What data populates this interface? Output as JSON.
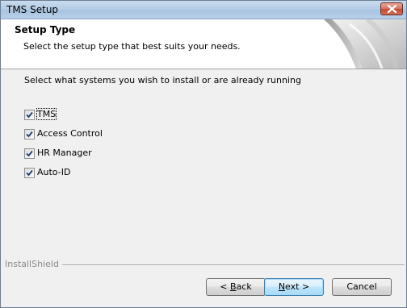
{
  "window": {
    "title": "TMS Setup"
  },
  "header": {
    "title": "Setup Type",
    "subtitle": "Select the setup type that best suits your needs."
  },
  "main": {
    "prompt": "Select what systems you wish to install or are already running",
    "options": [
      {
        "label": "TMS",
        "checked": true
      },
      {
        "label": "Access Control",
        "checked": true
      },
      {
        "label": "HR Manager",
        "checked": true
      },
      {
        "label": "Auto-ID",
        "checked": true
      }
    ]
  },
  "footer": {
    "brand": "InstallShield",
    "back": {
      "mnemonic": "B",
      "rest": "ack",
      "prefix": "< "
    },
    "next": {
      "mnemonic": "N",
      "rest": "ext",
      "suffix": " >"
    },
    "cancel": "Cancel"
  },
  "colors": {
    "accent": "#3c7fb1",
    "close": "#c24a34"
  }
}
